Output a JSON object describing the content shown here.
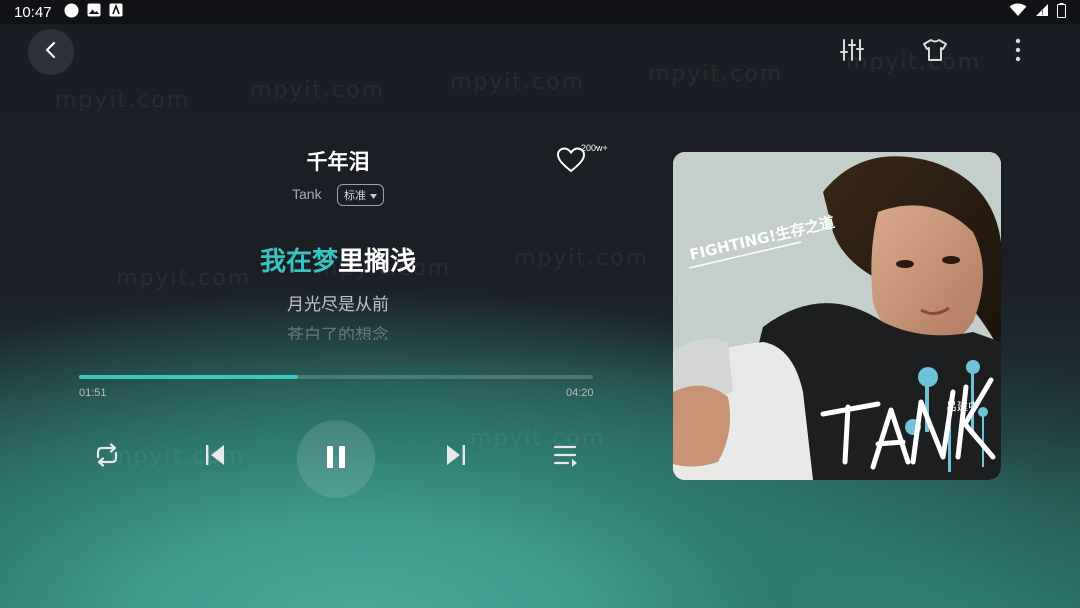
{
  "status_bar": {
    "time": "10:47"
  },
  "watermark": "mpyit.com",
  "top_bar": {
    "icons": [
      "back-icon",
      "equalizer-icon",
      "theme-shirt-icon",
      "more-vertical-icon"
    ]
  },
  "song": {
    "title": "千年泪",
    "artist": "Tank",
    "quality": "标准",
    "like_count": "200w+"
  },
  "lyrics": {
    "current_highlight": "我在梦",
    "current_rest": "里搁浅",
    "next": "月光尽是从前",
    "next2": "苍白了的想念"
  },
  "progress": {
    "current": "01:51",
    "total": "04:20",
    "fraction": 0.427
  },
  "controls": [
    "repeat-icon",
    "previous-icon",
    "pause-icon",
    "next-icon",
    "playlist-icon"
  ],
  "album": {
    "banner": "FIGHTING!生存之道",
    "logo": "TANK",
    "name_small": "吕建中"
  },
  "colors": {
    "accent": "#37c4c0",
    "background": "#1b1d24"
  }
}
